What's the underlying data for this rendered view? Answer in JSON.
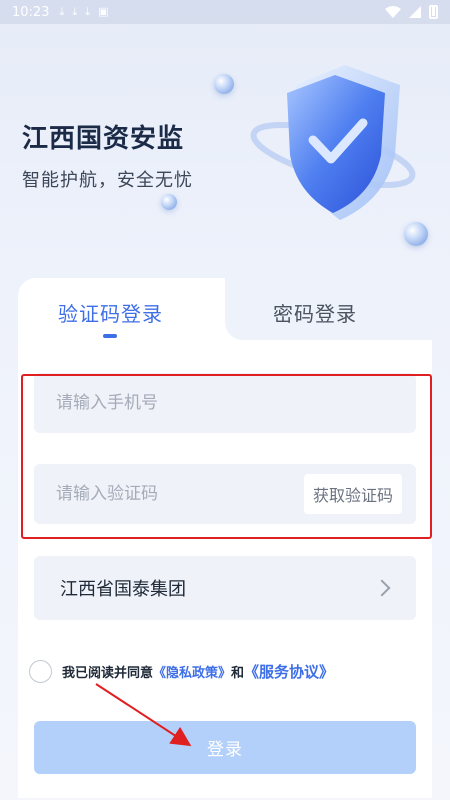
{
  "status_bar": {
    "time": "10:23",
    "left_icons": [
      "download-icon",
      "download-icon",
      "download-icon",
      "image-icon"
    ],
    "right_icons": [
      "wifi-icon",
      "signal-icon",
      "battery-icon"
    ]
  },
  "hero": {
    "title": "江西国资安监",
    "subtitle": "智能护航，安全无忧"
  },
  "tabs": {
    "active_label": "验证码登录",
    "inactive_label": "密码登录"
  },
  "form": {
    "phone_placeholder": "请输入手机号",
    "code_placeholder": "请输入验证码",
    "get_code_label": "获取验证码",
    "org_value": "江西省国泰集团"
  },
  "agreement": {
    "prefix": "我已阅读并同意",
    "privacy_link": "《隐私政策》",
    "conjunction": "和",
    "service_link": "《服务协议》"
  },
  "login_button": {
    "label": "登录"
  },
  "colors": {
    "accent": "#3f6fe8",
    "login_disabled": "#b3d0fb",
    "annotation_red": "#e02020"
  }
}
